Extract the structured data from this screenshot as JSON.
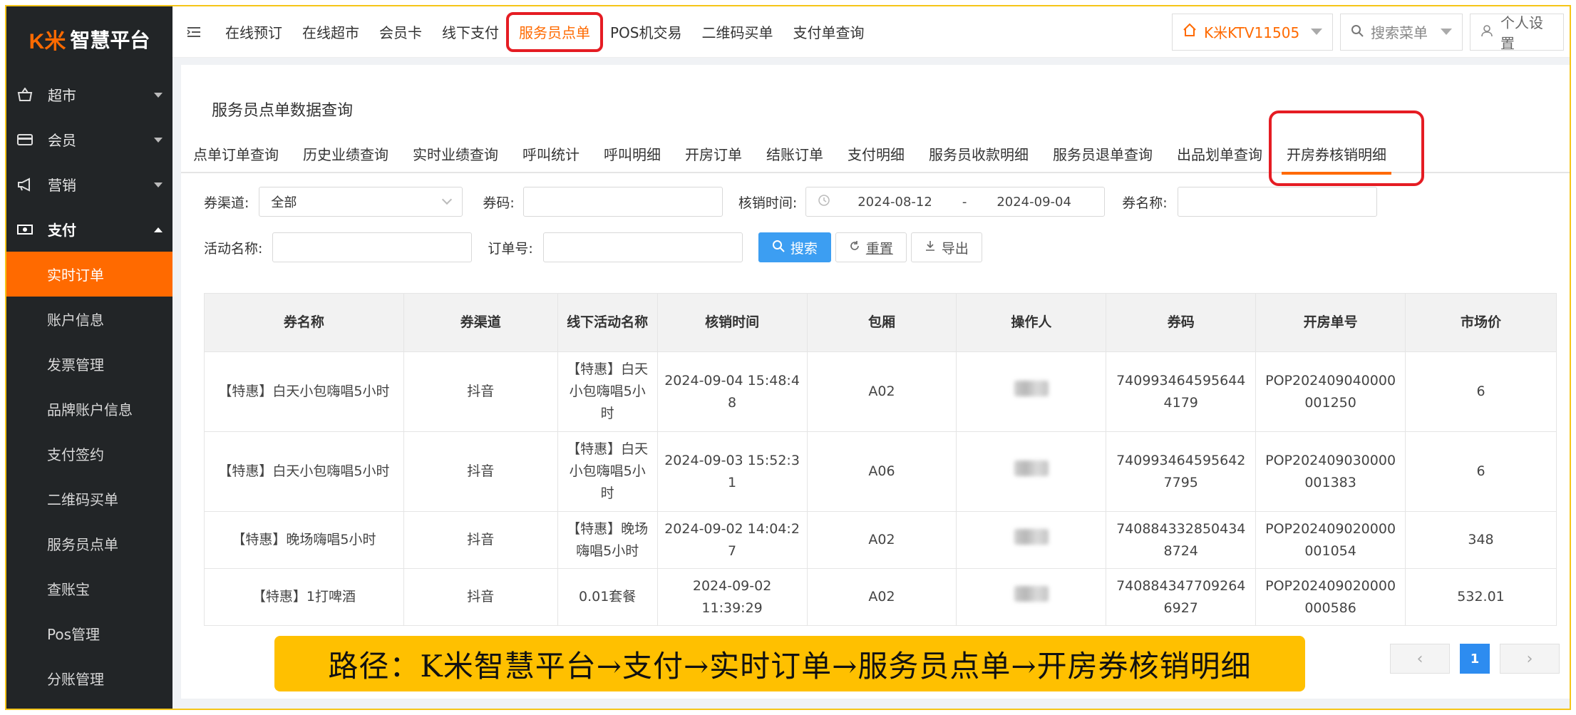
{
  "brand": {
    "logo_mark": "K米",
    "logo_text": "智慧平台",
    "accent": "#ff6a00"
  },
  "sidebar": {
    "groups": [
      {
        "label": "超市",
        "icon": "basket-icon"
      },
      {
        "label": "会员",
        "icon": "card-icon"
      },
      {
        "label": "营销",
        "icon": "megaphone-icon"
      },
      {
        "label": "支付",
        "icon": "money-icon"
      }
    ],
    "sub_items": [
      "实时订单",
      "账户信息",
      "发票管理",
      "品牌账户信息",
      "支付签约",
      "二维码买单",
      "服务员点单",
      "查账宝",
      "Pos管理",
      "分账管理"
    ]
  },
  "topnav": {
    "items": [
      "在线预订",
      "在线超市",
      "会员卡",
      "线下支付",
      "服务员点单",
      "POS机交易",
      "二维码买单",
      "支付单查询"
    ],
    "store": "K米KTV11505",
    "search_placeholder": "搜索菜单",
    "user": "个人设置"
  },
  "page": {
    "title": "服务员点单数据查询"
  },
  "tabs": [
    "点单订单查询",
    "历史业绩查询",
    "实时业绩查询",
    "呼叫统计",
    "呼叫明细",
    "开房订单",
    "结账订单",
    "支付明细",
    "服务员收款明细",
    "服务员退单查询",
    "出品划单查询",
    "开房券核销明细"
  ],
  "filters": {
    "channel_label": "券渠道:",
    "channel_value": "全部",
    "code_label": "券码:",
    "time_label": "核销时间:",
    "time_start": "2024-08-12",
    "time_sep": "-",
    "time_end": "2024-09-04",
    "coupon_name_label": "券名称:",
    "activity_label": "活动名称:",
    "order_label": "订单号:",
    "search_btn": "搜索",
    "reset_btn": "重置",
    "export_btn": "导出"
  },
  "table": {
    "headers": [
      "券名称",
      "券渠道",
      "线下活动名称",
      "核销时间",
      "包厢",
      "操作人",
      "券码",
      "开房单号",
      "市场价"
    ],
    "rows": [
      {
        "name": "【特惠】白天小包嗨唱5小时",
        "channel": "抖音",
        "activity": "【特惠】白天小包嗨唱5小时",
        "time": "2024-09-04 15:48:48",
        "room": "A02",
        "code": "7409934645956444179",
        "order": "POP202409040000001250",
        "price": "6"
      },
      {
        "name": "【特惠】白天小包嗨唱5小时",
        "channel": "抖音",
        "activity": "【特惠】白天小包嗨唱5小时",
        "time": "2024-09-03 15:52:31",
        "room": "A06",
        "code": "7409934645956427795",
        "order": "POP202409030000001383",
        "price": "6"
      },
      {
        "name": "【特惠】晚场嗨唱5小时",
        "channel": "抖音",
        "activity": "【特惠】晚场嗨唱5小时",
        "time": "2024-09-02 14:04:27",
        "room": "A02",
        "code": "7408843328504348724",
        "order": "POP202409020000001054",
        "price": "348"
      },
      {
        "name": "【特惠】1打啤酒",
        "channel": "抖音",
        "activity": "0.01套餐",
        "time": "2024-09-02 11:39:29",
        "room": "A02",
        "code": "7408843477092646927",
        "order": "POP202409020000000586",
        "price": "532.01"
      }
    ]
  },
  "pager": {
    "current": "1",
    "prev": "‹",
    "next": "›"
  },
  "banner": "路径：K米智慧平台→支付→实时订单→服务员点单→开房券核销明细"
}
